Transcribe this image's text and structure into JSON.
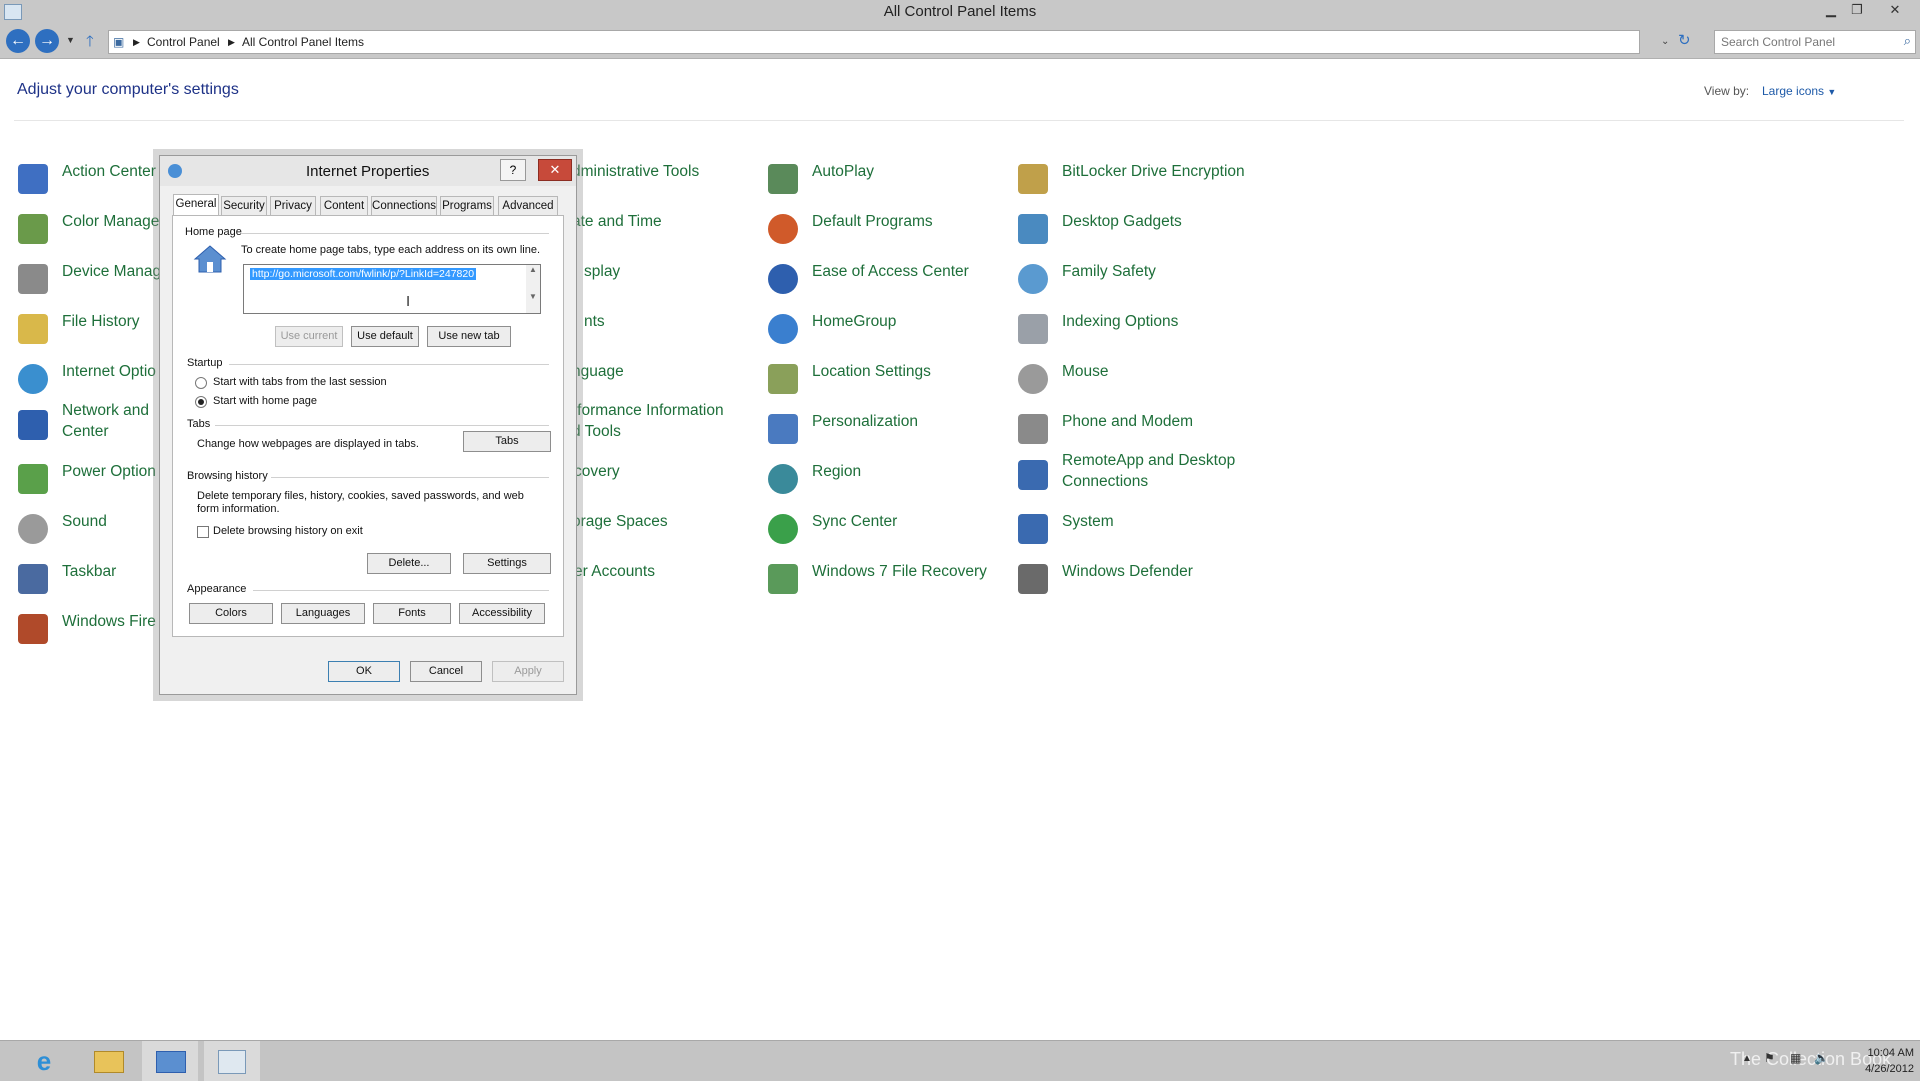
{
  "window": {
    "title": "All Control Panel Items"
  },
  "nav": {
    "breadcrumb": [
      "Control Panel",
      "All Control Panel Items"
    ],
    "search_placeholder": "Search Control Panel"
  },
  "header": {
    "title": "Adjust your computer's settings",
    "view_by_label": "View by:",
    "view_by_value": "Large icons"
  },
  "items": {
    "action_center": "Action Center",
    "color_management": "Color Manage",
    "device_manager": "Device Manag",
    "file_history": "File History",
    "internet_options": "Internet Optio",
    "network_line1": "Network and",
    "network_line2": "Center",
    "power_options": "Power Option",
    "sound": "Sound",
    "taskbar": "Taskbar",
    "windows_firewall": "Windows Fire",
    "admin_tools": "dministrative Tools",
    "date_time": "ate and Time",
    "display": "splay",
    "fonts": "nts",
    "language": "nguage",
    "perf_line1": "rformance Information",
    "perf_line2": "d Tools",
    "recovery": "covery",
    "storage_spaces": "orage Spaces",
    "user_accounts": "er Accounts",
    "autoplay": "AutoPlay",
    "default_programs": "Default Programs",
    "ease_of_access": "Ease of Access Center",
    "homegroup": "HomeGroup",
    "location_settings": "Location Settings",
    "personalization": "Personalization",
    "region": "Region",
    "sync_center": "Sync Center",
    "win7_recovery": "Windows 7 File Recovery",
    "bitlocker": "BitLocker Drive Encryption",
    "desktop_gadgets": "Desktop Gadgets",
    "family_safety": "Family Safety",
    "indexing_options": "Indexing Options",
    "mouse": "Mouse",
    "phone_modem": "Phone and Modem",
    "remoteapp_line1": "RemoteApp and Desktop",
    "remoteapp_line2": "Connections",
    "system": "System",
    "windows_defender": "Windows Defender"
  },
  "dialog": {
    "title": "Internet Properties",
    "help": "?",
    "close": "✕",
    "tabs": [
      "General",
      "Security",
      "Privacy",
      "Content",
      "Connections",
      "Programs",
      "Advanced"
    ],
    "home_page": {
      "label": "Home page",
      "hint": "To create home page tabs, type each address on its own line.",
      "url": "http://go.microsoft.com/fwlink/p/?LinkId=247820",
      "use_current": "Use current",
      "use_default": "Use default",
      "use_new_tab": "Use new tab"
    },
    "startup": {
      "label": "Startup",
      "option1": "Start with tabs from the last session",
      "option2": "Start with home page",
      "selected": "option2"
    },
    "tabs_section": {
      "label": "Tabs",
      "desc": "Change how webpages are displayed in tabs.",
      "button": "Tabs"
    },
    "browsing": {
      "label": "Browsing history",
      "desc_line1": "Delete temporary files, history, cookies, saved passwords, and web",
      "desc_line2": "form information.",
      "checkbox": "Delete browsing history on exit",
      "checked": false,
      "delete": "Delete...",
      "settings": "Settings"
    },
    "appearance": {
      "label": "Appearance",
      "colors": "Colors",
      "languages": "Languages",
      "fonts": "Fonts",
      "accessibility": "Accessibility"
    },
    "ok": "OK",
    "cancel": "Cancel",
    "apply": "Apply"
  },
  "taskbar": {
    "time": "10:04 AM",
    "date": "4/26/2012",
    "watermark": "The Collection Book"
  },
  "colors": {
    "link_green": "#1e6f3a",
    "heading_blue": "#1e3287",
    "accent_blue": "#3399ff",
    "close_red": "#c74a3a"
  }
}
